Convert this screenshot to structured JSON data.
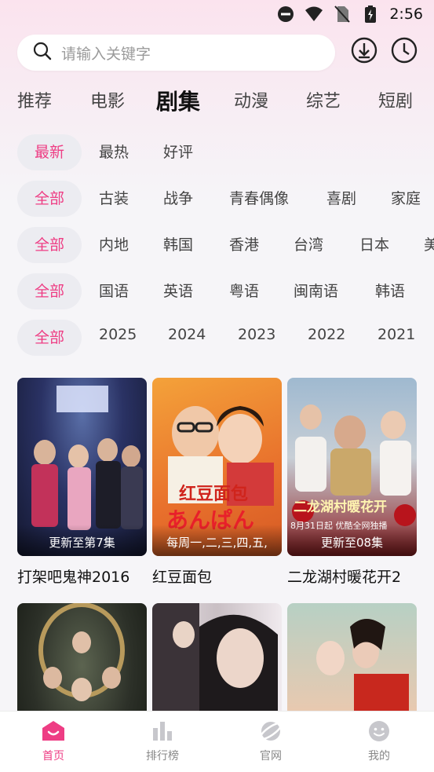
{
  "status_bar": {
    "time": "2:56"
  },
  "search": {
    "placeholder": "请输入关键字"
  },
  "tabs": [
    {
      "label": "推荐"
    },
    {
      "label": "电影"
    },
    {
      "label": "剧集"
    },
    {
      "label": "动漫"
    },
    {
      "label": "综艺"
    },
    {
      "label": "短剧"
    }
  ],
  "active_tab": "剧集",
  "filters": {
    "sort": [
      "最新",
      "最热",
      "好评"
    ],
    "genre": [
      "全部",
      "古装",
      "战争",
      "青春偶像",
      "喜剧",
      "家庭"
    ],
    "region": [
      "全部",
      "内地",
      "韩国",
      "香港",
      "台湾",
      "日本",
      "美"
    ],
    "language": [
      "全部",
      "国语",
      "英语",
      "粤语",
      "闽南语",
      "韩语"
    ],
    "year": [
      "全部",
      "2025",
      "2024",
      "2023",
      "2022",
      "2021"
    ]
  },
  "cards": [
    {
      "title": "打架吧鬼神2016",
      "caption": "更新至第7集"
    },
    {
      "title": "红豆面包",
      "caption": "每周一,二,三,四,五,",
      "poster_text": "红豆面包",
      "poster_text2": "あんぱん"
    },
    {
      "title": "二龙湖村暖花开2",
      "caption": "更新至08集",
      "poster_text": "二龙湖村暖花开",
      "poster_text2": "8月31日起 优酷全网独播"
    },
    {
      "title": "",
      "caption": ""
    },
    {
      "title": "",
      "caption": ""
    },
    {
      "title": "",
      "caption": ""
    }
  ],
  "bottom_nav": [
    {
      "label": "首页"
    },
    {
      "label": "排行榜"
    },
    {
      "label": "官网"
    },
    {
      "label": "我的"
    }
  ],
  "colors": {
    "accent": "#ee3d84",
    "chip_bg": "#ececf1",
    "nav_inactive": "#c7c7cc"
  }
}
